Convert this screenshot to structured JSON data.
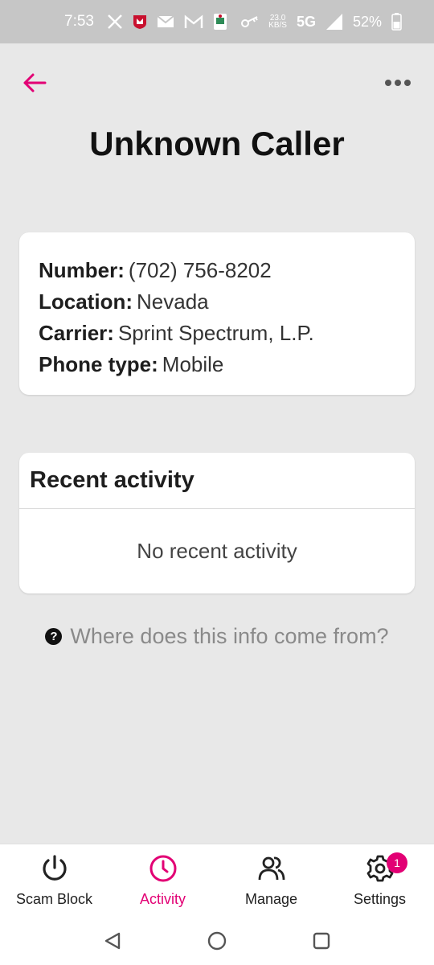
{
  "status_bar": {
    "time": "7:53",
    "speed_value": "23.0",
    "speed_unit": "KB/S",
    "network": "5G",
    "battery": "52%",
    "icons": [
      "x-icon",
      "mcafee-icon",
      "mail-icon",
      "gmail-icon",
      "app-icon",
      "vpn-key-icon",
      "signal-icon",
      "battery-icon"
    ]
  },
  "header": {
    "title": "Unknown Caller",
    "accent_color": "#e20074"
  },
  "caller_info": {
    "number_label": "Number:",
    "number_value": "(702) 756-8202",
    "location_label": "Location:",
    "location_value": "Nevada",
    "carrier_label": "Carrier:",
    "carrier_value": "Sprint Spectrum, L.P.",
    "phone_type_label": "Phone type:",
    "phone_type_value": "Mobile"
  },
  "recent_activity": {
    "title": "Recent activity",
    "empty_text": "No recent activity"
  },
  "info_link": {
    "text": "Where does this info come from?"
  },
  "bottom_nav": {
    "items": [
      {
        "label": "Scam Block",
        "icon": "power-icon"
      },
      {
        "label": "Activity",
        "icon": "clock-icon",
        "active": true
      },
      {
        "label": "Manage",
        "icon": "people-icon"
      },
      {
        "label": "Settings",
        "icon": "gear-icon",
        "badge": "1"
      }
    ]
  }
}
